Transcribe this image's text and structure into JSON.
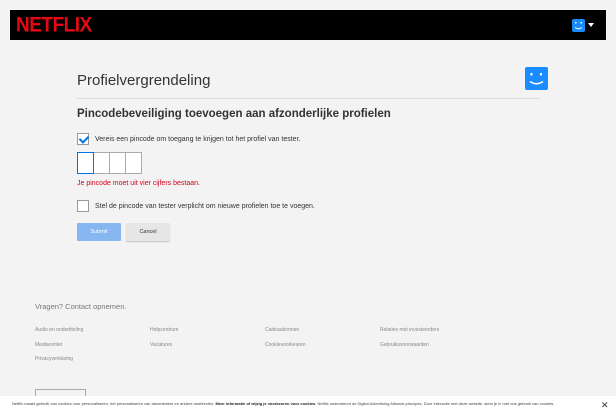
{
  "header": {
    "logo": "NETFLIX",
    "colors": {
      "brand": "#e50914",
      "avatar": "#1a8cff"
    },
    "avatar_icon": "smiley-avatar-icon",
    "dropdown_icon": "caret-down-icon"
  },
  "main": {
    "title": "Profielvergrendeling",
    "profile_icon": "smiley-avatar-icon",
    "subtitle": "Pincodebeveiliging toevoegen aan afzonderlijke profielen",
    "require_pin": {
      "label": "Vereis een pincode om toegang te krijgen tot het profiel van tester.",
      "checked": true
    },
    "pin": {
      "values": [
        "",
        "",
        "",
        ""
      ],
      "error": "Je pincode moet uit vier cijfers bestaan."
    },
    "new_profile_pin": {
      "label": "Stel de pincode van tester verplicht om nieuwe profielen toe te voegen.",
      "checked": false
    },
    "buttons": {
      "submit": "Submit",
      "cancel": "Cancel"
    }
  },
  "footer": {
    "contact": "Vragen? Contact opnemen.",
    "links": [
      [
        "Audio en ondertiteling",
        "Helpcentrum",
        "Cadeaubonnen",
        "Relaties met investeerders"
      ],
      [
        "Mediacenter",
        "Vacatures",
        "Cookievoorkeuren",
        "Gebruiksvoorwaarden"
      ],
      [
        "Privacyverklaring"
      ]
    ]
  },
  "cookie": {
    "text_before": "Netflix maakt gebruik van cookies voor personaliseren, het personaliseren van advertenties en andere doeleinden. ",
    "link": "Meer informatie of wijzig je voorkeuren voor cookies",
    "text_after": ". Netflix ondersteunt de Digital Advertising Alliance-principes. Door interactie met deze website, stem je in met ons gebruik van cookies.",
    "close_icon": "close-icon"
  }
}
